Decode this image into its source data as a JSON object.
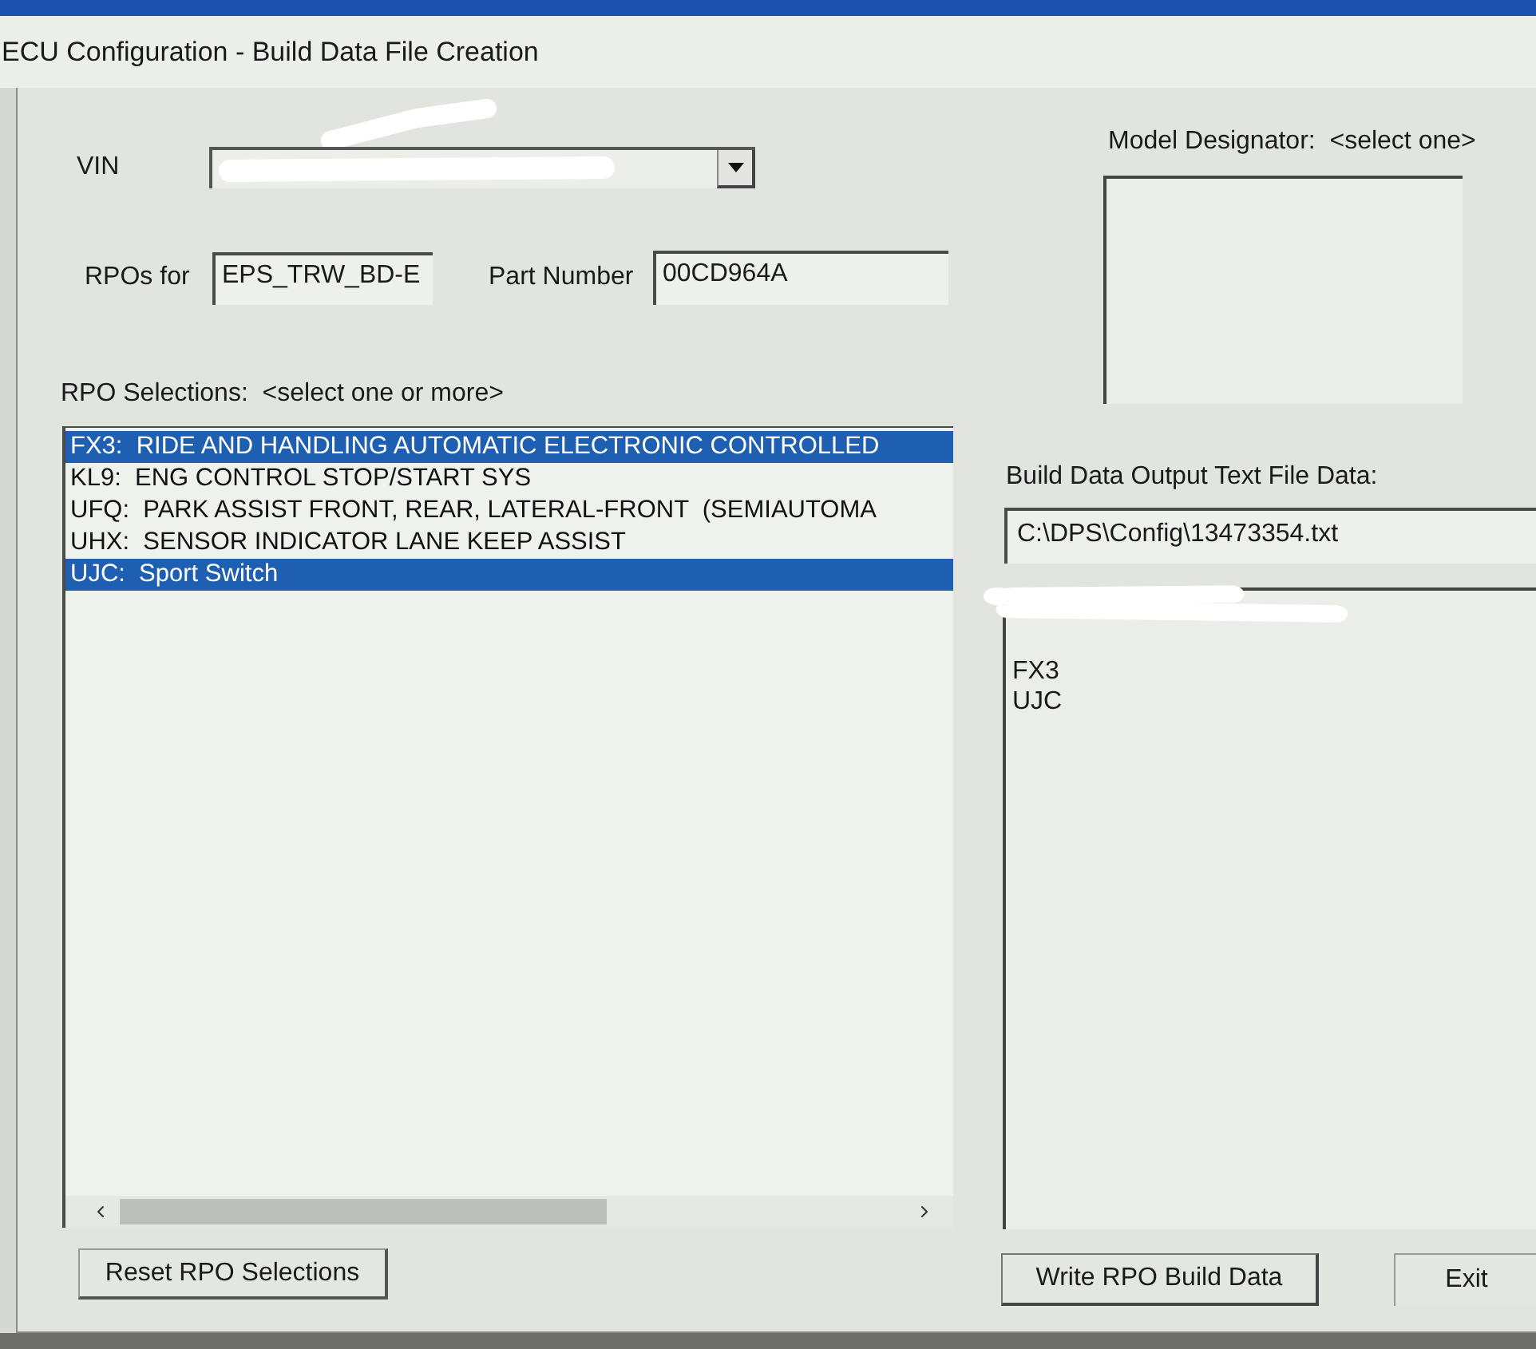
{
  "window": {
    "title": "ECU Configuration - Build Data File Creation"
  },
  "vin": {
    "label": "VIN",
    "redacted": true
  },
  "rpos_for": {
    "label": "RPOs for",
    "value": "EPS_TRW_BD-E"
  },
  "part_number": {
    "label": "Part Number",
    "value": "00CD964A"
  },
  "model_designator": {
    "label": "Model Designator:  <select one>"
  },
  "rpo_selections": {
    "label": "RPO Selections:  <select one or more>",
    "items": [
      {
        "label": "FX3:  RIDE AND HANDLING AUTOMATIC ELECTRONIC CONTROLLED",
        "selected": true
      },
      {
        "label": "KL9:  ENG CONTROL STOP/START SYS",
        "selected": false
      },
      {
        "label": "UFQ:  PARK ASSIST FRONT, REAR, LATERAL-FRONT  (SEMIAUTOMA",
        "selected": false
      },
      {
        "label": "UHX:  SENSOR INDICATOR LANE KEEP ASSIST",
        "selected": false
      },
      {
        "label": "UJC:  Sport Switch",
        "selected": true
      }
    ]
  },
  "output": {
    "label": "Build Data Output Text File Data:",
    "file_path": "C:\\DPS\\Config\\13473354.txt",
    "first_line_redacted": true,
    "lines": [
      "FX3",
      "UJC"
    ]
  },
  "buttons": {
    "reset": "Reset RPO Selections",
    "write": "Write RPO Build Data",
    "exit": "Exit"
  }
}
